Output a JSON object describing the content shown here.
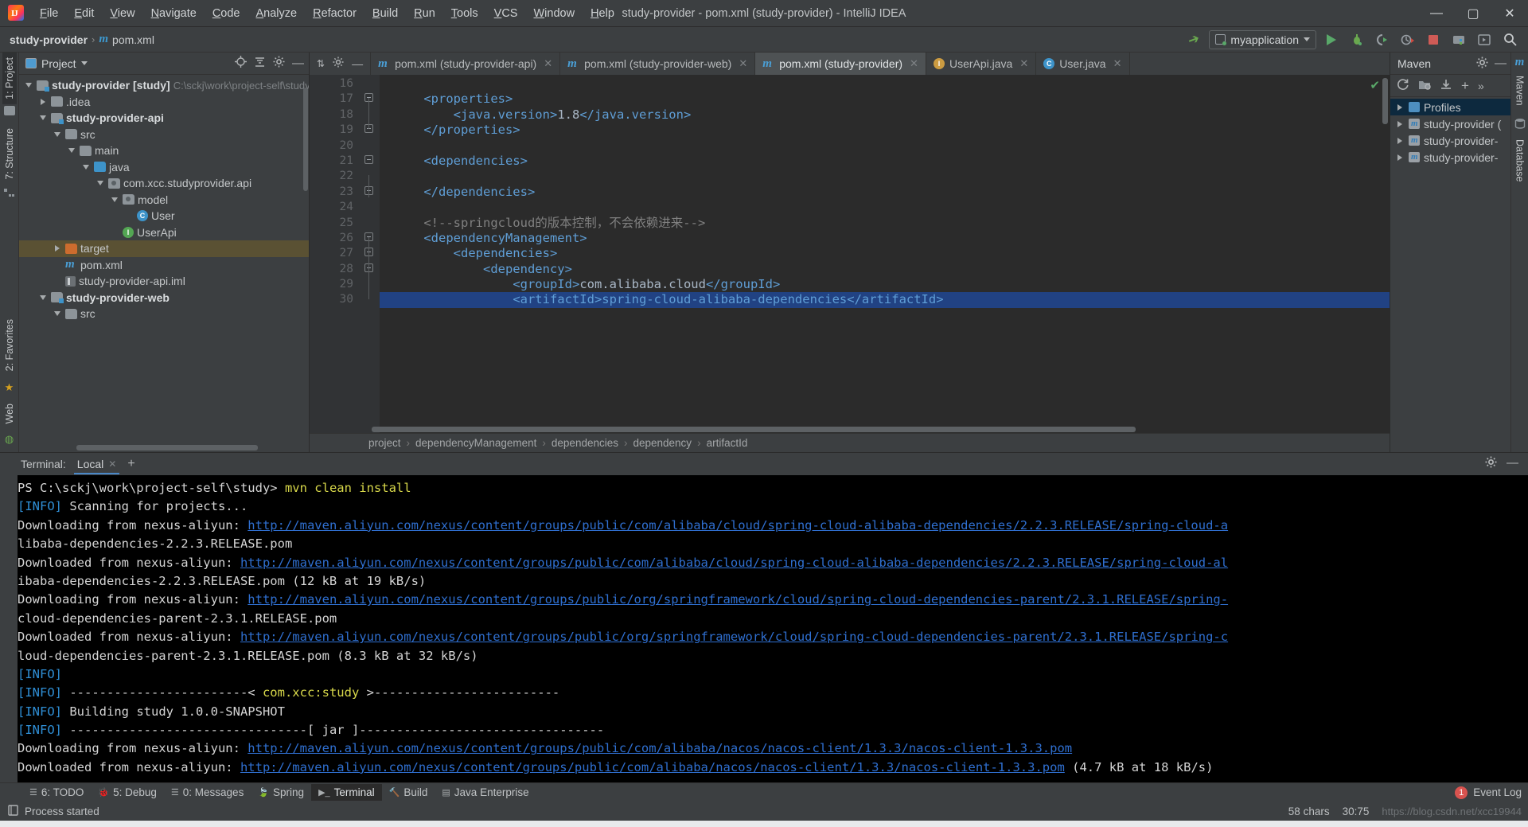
{
  "window": {
    "title": "study-provider - pom.xml (study-provider) - IntelliJ IDEA",
    "minimize": "—",
    "maximize": "▢",
    "close": "✕"
  },
  "menu": [
    "File",
    "Edit",
    "View",
    "Navigate",
    "Code",
    "Analyze",
    "Refactor",
    "Build",
    "Run",
    "Tools",
    "VCS",
    "Window",
    "Help"
  ],
  "navbar": {
    "project": "study-provider",
    "separator": "›",
    "file": "pom.xml",
    "run_config": "myapplication",
    "icons": [
      "hammer-icon",
      "run-icon",
      "debug-icon",
      "run-coverage-icon",
      "profiler-icon",
      "stop-icon",
      "project-structure-icon",
      "updates-icon",
      "search-everywhere-icon"
    ]
  },
  "left_rail": {
    "tabs": [
      "1: Project",
      "7: Structure"
    ],
    "active": "1: Project"
  },
  "project_panel": {
    "title": "Project",
    "actions": [
      "locate-icon",
      "collapse-all-icon",
      "settings-icon",
      "hide-icon"
    ],
    "tree": [
      {
        "indent": 0,
        "twisty": "down",
        "icon": "module-folder",
        "label": "study-provider",
        "bold": true,
        "suffix": "[study]",
        "path": "C:\\sckj\\work\\project-self\\study",
        "selected": false
      },
      {
        "indent": 1,
        "twisty": "right",
        "icon": "folder",
        "label": ".idea",
        "bold": false,
        "suffix": "",
        "path": "",
        "selected": false
      },
      {
        "indent": 1,
        "twisty": "down",
        "icon": "module-folder",
        "label": "study-provider-api",
        "bold": true,
        "suffix": "",
        "path": "",
        "selected": false
      },
      {
        "indent": 2,
        "twisty": "down",
        "icon": "folder",
        "label": "src",
        "bold": false,
        "suffix": "",
        "path": "",
        "selected": false
      },
      {
        "indent": 3,
        "twisty": "down",
        "icon": "folder",
        "label": "main",
        "bold": false,
        "suffix": "",
        "path": "",
        "selected": false
      },
      {
        "indent": 4,
        "twisty": "down",
        "icon": "source-folder",
        "label": "java",
        "bold": false,
        "suffix": "",
        "path": "",
        "selected": false
      },
      {
        "indent": 5,
        "twisty": "down",
        "icon": "package",
        "label": "com.xcc.studyprovider.api",
        "bold": false,
        "suffix": "",
        "path": "",
        "selected": false
      },
      {
        "indent": 6,
        "twisty": "down",
        "icon": "package",
        "label": "model",
        "bold": false,
        "suffix": "",
        "path": "",
        "selected": false
      },
      {
        "indent": 7,
        "twisty": "none",
        "icon": "class",
        "label": "User",
        "bold": false,
        "suffix": "",
        "path": "",
        "selected": false
      },
      {
        "indent": 6,
        "twisty": "none",
        "icon": "interface",
        "label": "UserApi",
        "bold": false,
        "suffix": "",
        "path": "",
        "selected": false
      },
      {
        "indent": 2,
        "twisty": "right",
        "icon": "target-folder",
        "label": "target",
        "bold": false,
        "suffix": "",
        "path": "",
        "selected": true
      },
      {
        "indent": 2,
        "twisty": "none",
        "icon": "maven",
        "label": "pom.xml",
        "bold": false,
        "suffix": "",
        "path": "",
        "selected": false
      },
      {
        "indent": 2,
        "twisty": "none",
        "icon": "iml",
        "label": "study-provider-api.iml",
        "bold": false,
        "suffix": "",
        "path": "",
        "selected": false
      },
      {
        "indent": 1,
        "twisty": "down",
        "icon": "module-folder",
        "label": "study-provider-web",
        "bold": true,
        "suffix": "",
        "path": "",
        "selected": false
      },
      {
        "indent": 2,
        "twisty": "down",
        "icon": "folder",
        "label": "src",
        "bold": false,
        "suffix": "",
        "path": "",
        "selected": false
      }
    ]
  },
  "editor": {
    "tabs": [
      {
        "label": "pom.xml (study-provider-api)",
        "icon": "maven-icon",
        "active": false,
        "close": "✕"
      },
      {
        "label": "pom.xml (study-provider-web)",
        "icon": "maven-icon",
        "active": false,
        "close": "✕"
      },
      {
        "label": "pom.xml (study-provider)",
        "icon": "maven-icon",
        "active": true,
        "close": "✕"
      },
      {
        "label": "UserApi.java",
        "icon": "interface-icon",
        "active": false,
        "close": "✕"
      },
      {
        "label": "User.java",
        "icon": "class-icon",
        "active": false,
        "close": "✕"
      }
    ],
    "first_line_number": 16,
    "lines": [
      {
        "num": 16,
        "fold": "none",
        "segments": [],
        "selected": false
      },
      {
        "num": 17,
        "fold": "open",
        "segments": [
          {
            "t": "    ",
            "c": "txt"
          },
          {
            "t": "<properties>",
            "c": "xtag"
          }
        ],
        "selected": false
      },
      {
        "num": 18,
        "fold": "none",
        "segments": [
          {
            "t": "        ",
            "c": "txt"
          },
          {
            "t": "<java.version>",
            "c": "xtag"
          },
          {
            "t": "1.8",
            "c": "txt"
          },
          {
            "t": "</java.version>",
            "c": "xtag"
          }
        ],
        "selected": false
      },
      {
        "num": 19,
        "fold": "close",
        "segments": [
          {
            "t": "    ",
            "c": "txt"
          },
          {
            "t": "</properties>",
            "c": "xtag"
          }
        ],
        "selected": false
      },
      {
        "num": 20,
        "fold": "none",
        "segments": [],
        "selected": false
      },
      {
        "num": 21,
        "fold": "open",
        "segments": [
          {
            "t": "    ",
            "c": "txt"
          },
          {
            "t": "<dependencies>",
            "c": "xtag"
          }
        ],
        "selected": false
      },
      {
        "num": 22,
        "fold": "none",
        "segments": [],
        "selected": false
      },
      {
        "num": 23,
        "fold": "close",
        "segments": [
          {
            "t": "    ",
            "c": "txt"
          },
          {
            "t": "</dependencies>",
            "c": "xtag"
          }
        ],
        "selected": false
      },
      {
        "num": 24,
        "fold": "none",
        "segments": [],
        "selected": false
      },
      {
        "num": 25,
        "fold": "none",
        "segments": [
          {
            "t": "    ",
            "c": "txt"
          },
          {
            "t": "<!--springcloud的版本控制，不会依赖进来-->",
            "c": "cmt"
          }
        ],
        "selected": false
      },
      {
        "num": 26,
        "fold": "open",
        "segments": [
          {
            "t": "    ",
            "c": "txt"
          },
          {
            "t": "<dependencyManagement>",
            "c": "xtag"
          }
        ],
        "selected": false
      },
      {
        "num": 27,
        "fold": "open",
        "segments": [
          {
            "t": "        ",
            "c": "txt"
          },
          {
            "t": "<dependencies>",
            "c": "xtag"
          }
        ],
        "selected": false
      },
      {
        "num": 28,
        "fold": "open",
        "segments": [
          {
            "t": "            ",
            "c": "txt"
          },
          {
            "t": "<dependency>",
            "c": "xtag"
          }
        ],
        "selected": false
      },
      {
        "num": 29,
        "fold": "none",
        "segments": [
          {
            "t": "                ",
            "c": "txt"
          },
          {
            "t": "<groupId>",
            "c": "xtag"
          },
          {
            "t": "com.alibaba.cloud",
            "c": "txt"
          },
          {
            "t": "</groupId>",
            "c": "xtag"
          }
        ],
        "selected": false
      },
      {
        "num": 30,
        "fold": "none",
        "segments": [
          {
            "t": "                ",
            "c": "txt"
          },
          {
            "t": "<artifactId>spring-cloud-alibaba-dependencies</artifactId>",
            "c": "xtag"
          }
        ],
        "selected": true
      }
    ],
    "breadcrumbs": [
      "project",
      "dependencyManagement",
      "dependencies",
      "dependency",
      "artifactId"
    ],
    "breadcrumb_sep": "›",
    "inspection_status": "inspections-ok-icon"
  },
  "maven_panel": {
    "title": "Maven",
    "head_actions": [
      "settings-icon",
      "hide-icon"
    ],
    "toolbar": [
      "reload-icon",
      "generate-sources-icon",
      "download-sources-icon",
      "add-icon",
      "more-icon"
    ],
    "tree": [
      {
        "label": "Profiles",
        "icon": "profiles-icon",
        "selected": true
      },
      {
        "label": "study-provider (",
        "icon": "maven-project-icon",
        "selected": false
      },
      {
        "label": "study-provider-",
        "icon": "maven-project-icon",
        "selected": false
      },
      {
        "label": "study-provider-",
        "icon": "maven-project-icon",
        "selected": false
      }
    ]
  },
  "right_rail": {
    "tabs": [
      "Maven",
      "Database"
    ]
  },
  "terminal": {
    "label": "Terminal:",
    "tab": "Local",
    "tab_close": "✕",
    "add": "+",
    "actions": [
      "settings-icon",
      "hide-icon"
    ],
    "highlighted_command": "mvn clean install",
    "lines": [
      [
        {
          "t": "PS C:\\sckj\\work\\project-self\\study> ",
          "c": "plain"
        },
        {
          "t": "mvn clean install",
          "c": "yellow"
        }
      ],
      [
        {
          "t": "[INFO]",
          "c": "info"
        },
        {
          "t": " Scanning for projects...",
          "c": "plain"
        }
      ],
      [
        {
          "t": "Downloading from nexus-aliyun: ",
          "c": "plain"
        },
        {
          "t": "http://maven.aliyun.com/nexus/content/groups/public/com/alibaba/cloud/spring-cloud-alibaba-dependencies/2.2.3.RELEASE/spring-cloud-a",
          "c": "link"
        }
      ],
      [
        {
          "t": "libaba-dependencies-2.2.3.RELEASE.pom",
          "c": "plain"
        }
      ],
      [
        {
          "t": "Downloaded from nexus-aliyun: ",
          "c": "plain"
        },
        {
          "t": "http://maven.aliyun.com/nexus/content/groups/public/com/alibaba/cloud/spring-cloud-alibaba-dependencies/2.2.3.RELEASE/spring-cloud-al",
          "c": "link"
        }
      ],
      [
        {
          "t": "ibaba-dependencies-2.2.3.RELEASE.pom (12 kB at 19 kB/s)",
          "c": "plain"
        }
      ],
      [
        {
          "t": "Downloading from nexus-aliyun: ",
          "c": "plain"
        },
        {
          "t": "http://maven.aliyun.com/nexus/content/groups/public/org/springframework/cloud/spring-cloud-dependencies-parent/2.3.1.RELEASE/spring-",
          "c": "link"
        }
      ],
      [
        {
          "t": "cloud-dependencies-parent-2.3.1.RELEASE.pom",
          "c": "plain"
        }
      ],
      [
        {
          "t": "Downloaded from nexus-aliyun: ",
          "c": "plain"
        },
        {
          "t": "http://maven.aliyun.com/nexus/content/groups/public/org/springframework/cloud/spring-cloud-dependencies-parent/2.3.1.RELEASE/spring-c",
          "c": "link"
        }
      ],
      [
        {
          "t": "loud-dependencies-parent-2.3.1.RELEASE.pom (8.3 kB at 32 kB/s)",
          "c": "plain"
        }
      ],
      [
        {
          "t": "[INFO]",
          "c": "info"
        }
      ],
      [
        {
          "t": "[INFO]",
          "c": "info"
        },
        {
          "t": " ------------------------< ",
          "c": "plain"
        },
        {
          "t": "com.xcc:study",
          "c": "yellow"
        },
        {
          "t": " >-------------------------",
          "c": "plain"
        }
      ],
      [
        {
          "t": "[INFO]",
          "c": "info"
        },
        {
          "t": " Building study 1.0.0-SNAPSHOT",
          "c": "plain"
        }
      ],
      [
        {
          "t": "[INFO]",
          "c": "info"
        },
        {
          "t": " --------------------------------[ jar ]---------------------------------",
          "c": "plain"
        }
      ],
      [
        {
          "t": "Downloading from nexus-aliyun: ",
          "c": "plain"
        },
        {
          "t": "http://maven.aliyun.com/nexus/content/groups/public/com/alibaba/nacos/nacos-client/1.3.3/nacos-client-1.3.3.pom",
          "c": "link"
        }
      ],
      [
        {
          "t": "Downloaded from nexus-aliyun: ",
          "c": "plain"
        },
        {
          "t": "http://maven.aliyun.com/nexus/content/groups/public/com/alibaba/nacos/nacos-client/1.3.3/nacos-client-1.3.3.pom",
          "c": "link"
        },
        {
          "t": " (4.7 kB at 18 kB/s)",
          "c": "plain"
        }
      ]
    ]
  },
  "tool_window_bar": {
    "items": [
      {
        "label": "6: TODO",
        "icon": "todo-icon",
        "active": false
      },
      {
        "label": "5: Debug",
        "icon": "debug-icon",
        "active": false
      },
      {
        "label": "0: Messages",
        "icon": "messages-icon",
        "active": false
      },
      {
        "label": "Spring",
        "icon": "spring-icon",
        "active": false
      },
      {
        "label": "Terminal",
        "icon": "terminal-icon",
        "active": true
      },
      {
        "label": "Build",
        "icon": "build-icon",
        "active": false
      },
      {
        "label": "Java Enterprise",
        "icon": "java-enterprise-icon",
        "active": false
      }
    ],
    "event_log": "Event Log",
    "event_log_count": "1"
  },
  "statusbar": {
    "message": "Process started",
    "chars": "58 chars",
    "position": "30:75",
    "watermark": "https://blog.csdn.net/xcc19944"
  },
  "colors": {
    "accent_blue": "#4a88c7",
    "selection_blue": "#214283",
    "tree_selection": "#5a5133",
    "green_run": "#59a869",
    "red_stop": "#cf5b56",
    "highlight_red": "#ef2b2b",
    "terminal_bg": "#000000",
    "editor_bg": "#2b2b2b",
    "panel_bg": "#3c3f41"
  }
}
